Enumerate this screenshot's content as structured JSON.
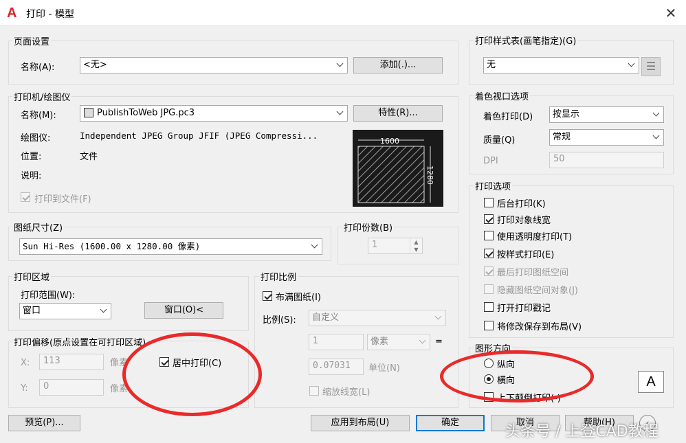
{
  "title": "打印 - 模型",
  "page_setup": {
    "label": "页面设置",
    "name_label": "名称(A):",
    "name_value": "<无>",
    "add_button": "添加(.)..."
  },
  "printer": {
    "label": "打印机/绘图仪",
    "name_label": "名称(M):",
    "name_value": "PublishToWeb JPG.pc3",
    "props_button": "特性(R)...",
    "plotter_label": "绘图仪:",
    "plotter_value": "Independent JPEG Group JFIF (JPEG Compressi...",
    "location_label": "位置:",
    "location_value": "文件",
    "desc_label": "说明:",
    "print_to_file": "打印到文件(F)",
    "preview_width": "1600",
    "preview_height": "1280"
  },
  "paper_size": {
    "label": "图纸尺寸(Z)",
    "value": "Sun Hi-Res (1600.00 x 1280.00 像素)"
  },
  "copies": {
    "label": "打印份数(B)",
    "value": "1"
  },
  "plot_area": {
    "label": "打印区域",
    "range_label": "打印范围(W):",
    "range_value": "窗口",
    "window_button": "窗口(O)<"
  },
  "plot_offset": {
    "label": "打印偏移(原点设置在可打印区域)",
    "x_label": "X:",
    "x_value": "113",
    "x_unit": "像素",
    "y_label": "Y:",
    "y_value": "0",
    "y_unit": "像素",
    "center_label": "居中打印(C)"
  },
  "plot_scale": {
    "label": "打印比例",
    "fit_label": "布满图纸(I)",
    "scale_label": "比例(S):",
    "scale_value": "自定义",
    "num_value": "1",
    "num_unit": "像素",
    "eq": "=",
    "den_value": "0.07031",
    "den_unit": "单位(N)",
    "lineweights_label": "缩放线宽(L)"
  },
  "style_table": {
    "label": "打印样式表(画笔指定)(G)",
    "value": "无"
  },
  "shaded": {
    "label": "着色视口选项",
    "shade_label": "着色打印(D)",
    "shade_value": "按显示",
    "quality_label": "质量(Q)",
    "quality_value": "常规",
    "dpi_label": "DPI",
    "dpi_value": "50"
  },
  "options": {
    "label": "打印选项",
    "items": [
      {
        "label": "后台打印(K)"
      },
      {
        "label": "打印对象线宽"
      },
      {
        "label": "使用透明度打印(T)"
      },
      {
        "label": "按样式打印(E)"
      },
      {
        "label": "最后打印图纸空间"
      },
      {
        "label": "隐藏图纸空间对象(J)"
      },
      {
        "label": "打开打印戳记"
      },
      {
        "label": "将修改保存到布局(V)"
      }
    ]
  },
  "orientation": {
    "label": "图形方向",
    "portrait": "纵向",
    "landscape": "横向",
    "upside_down": "上下颠倒打印(-)",
    "icon_letter": "A"
  },
  "buttons": {
    "preview": "预览(P)...",
    "apply": "应用到布局(U)",
    "ok": "确定",
    "cancel": "取消",
    "help": "帮助(H)"
  },
  "watermark": "头条号 / 上登CAD教程",
  "colors": {
    "annotation": "#ea2a2a",
    "accent": "#0078d7"
  }
}
